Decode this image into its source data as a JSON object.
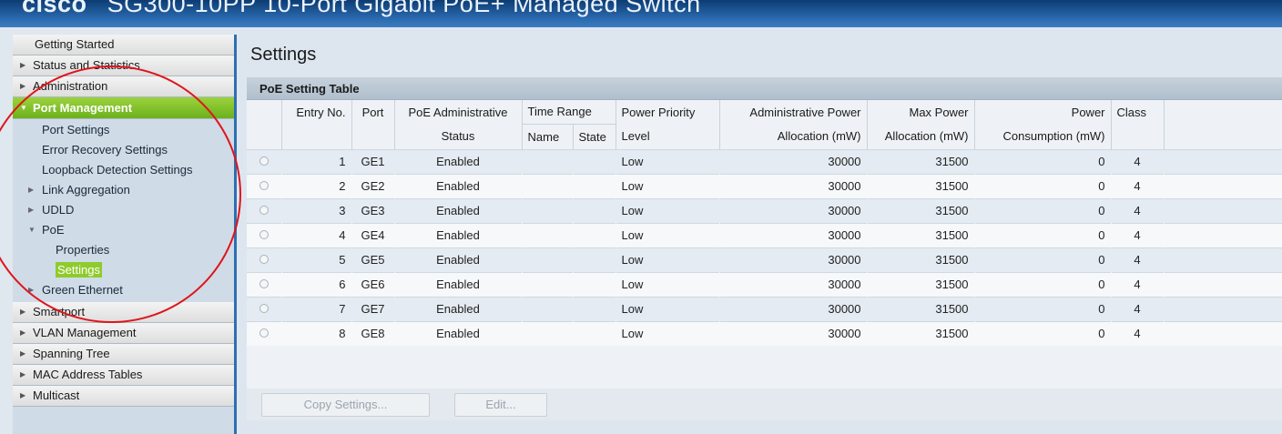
{
  "banner": {
    "logo": "cisco",
    "title": "SG300-10PP 10-Port Gigabit PoE+ Managed Switch"
  },
  "sidebar": {
    "getting_started": "Getting Started",
    "status_stats": "Status and Statistics",
    "administration": "Administration",
    "port_management": "Port Management",
    "port_settings": "Port Settings",
    "error_recovery": "Error Recovery Settings",
    "loopback": "Loopback Detection Settings",
    "link_aggregation": "Link Aggregation",
    "udld": "UDLD",
    "poe": "PoE",
    "poe_properties": "Properties",
    "poe_settings": "Settings",
    "green_ethernet": "Green Ethernet",
    "smartport": "Smartport",
    "vlan_management": "VLAN Management",
    "spanning_tree": "Spanning Tree",
    "mac_tables": "MAC Address Tables",
    "multicast": "Multicast"
  },
  "main": {
    "title": "Settings",
    "table_caption": "PoE Setting Table",
    "columns": {
      "entry_no": "Entry No.",
      "port": "Port",
      "poe_admin_1": "PoE Administrative",
      "poe_admin_2": "Status",
      "time_range": "Time Range",
      "tr_name": "Name",
      "tr_state": "State",
      "power_priority_1": "Power Priority",
      "power_priority_2": "Level",
      "admin_power_1": "Administrative Power",
      "admin_power_2": "Allocation (mW)",
      "max_power_1": "Max Power",
      "max_power_2": "Allocation (mW)",
      "power_cons_1": "Power",
      "power_cons_2": "Consumption (mW)",
      "class": "Class"
    },
    "rows": [
      {
        "entry": "1",
        "port": "GE1",
        "status": "Enabled",
        "priority": "Low",
        "admin_alloc": "30000",
        "max_alloc": "31500",
        "consumption": "0",
        "class": "4"
      },
      {
        "entry": "2",
        "port": "GE2",
        "status": "Enabled",
        "priority": "Low",
        "admin_alloc": "30000",
        "max_alloc": "31500",
        "consumption": "0",
        "class": "4"
      },
      {
        "entry": "3",
        "port": "GE3",
        "status": "Enabled",
        "priority": "Low",
        "admin_alloc": "30000",
        "max_alloc": "31500",
        "consumption": "0",
        "class": "4"
      },
      {
        "entry": "4",
        "port": "GE4",
        "status": "Enabled",
        "priority": "Low",
        "admin_alloc": "30000",
        "max_alloc": "31500",
        "consumption": "0",
        "class": "4"
      },
      {
        "entry": "5",
        "port": "GE5",
        "status": "Enabled",
        "priority": "Low",
        "admin_alloc": "30000",
        "max_alloc": "31500",
        "consumption": "0",
        "class": "4"
      },
      {
        "entry": "6",
        "port": "GE6",
        "status": "Enabled",
        "priority": "Low",
        "admin_alloc": "30000",
        "max_alloc": "31500",
        "consumption": "0",
        "class": "4"
      },
      {
        "entry": "7",
        "port": "GE7",
        "status": "Enabled",
        "priority": "Low",
        "admin_alloc": "30000",
        "max_alloc": "31500",
        "consumption": "0",
        "class": "4"
      },
      {
        "entry": "8",
        "port": "GE8",
        "status": "Enabled",
        "priority": "Low",
        "admin_alloc": "30000",
        "max_alloc": "31500",
        "consumption": "0",
        "class": "4"
      }
    ],
    "buttons": {
      "copy_settings": "Copy Settings...",
      "edit": "Edit..."
    }
  },
  "colors": {
    "active_nav": "#7cc02a",
    "banner": "#2b6bb0",
    "annotation": "#e0141b"
  },
  "icons": {
    "collapsed": "triangle-right",
    "expanded": "triangle-down"
  }
}
